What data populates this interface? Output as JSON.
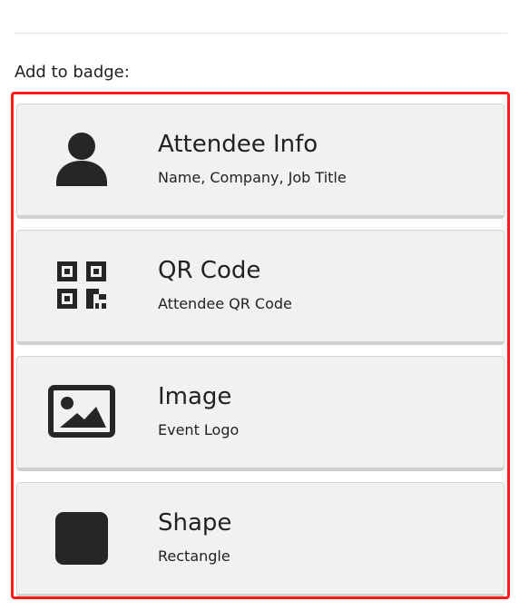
{
  "section": {
    "label": "Add to badge:"
  },
  "options": [
    {
      "title": "Attendee Info",
      "subtitle": "Name, Company, Job Title",
      "icon": "user-icon"
    },
    {
      "title": "QR Code",
      "subtitle": "Attendee QR Code",
      "icon": "qr-code-icon"
    },
    {
      "title": "Image",
      "subtitle": "Event Logo",
      "icon": "image-icon"
    },
    {
      "title": "Shape",
      "subtitle": "Rectangle",
      "icon": "rectangle-icon"
    }
  ],
  "colors": {
    "highlight_border": "#ff1a1a",
    "card_background": "#f1f1f1",
    "icon_color": "#262626"
  }
}
